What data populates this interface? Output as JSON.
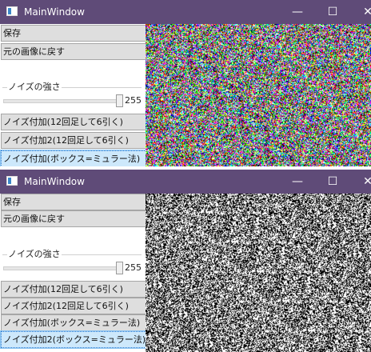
{
  "windows": [
    {
      "title": "MainWindow",
      "controls": {
        "minimize": "—",
        "maximize": "☐",
        "close": "✕"
      },
      "buttons": {
        "save": "保存",
        "restore": "元の画像に戻す",
        "noise1": "ノイズ付加(12回足して6引く)",
        "noise2": "ノイズ付加2(12回足して6引く)",
        "noise3": "ノイズ付加(ボックス=ミュラー法)"
      },
      "noise_group": {
        "label": "ノイズの強さ",
        "value": "255",
        "level": 1.0
      },
      "preview_style": "color-noise"
    },
    {
      "title": "MainWindow",
      "controls": {
        "minimize": "—",
        "maximize": "☐",
        "close": "✕"
      },
      "buttons": {
        "save": "保存",
        "restore": "元の画像に戻す",
        "noise1": "ノイズ付加(12回足して6引く)",
        "noise2": "ノイズ付加2(12回足して6引く)",
        "noise3": "ノイズ付加(ボックス=ミュラー法)",
        "noise4": "ノイズ付加2(ボックス=ミュラー法)"
      },
      "noise_group": {
        "label": "ノイズの強さ",
        "value": "255",
        "level": 1.0
      },
      "preview_style": "bw-noise"
    }
  ]
}
